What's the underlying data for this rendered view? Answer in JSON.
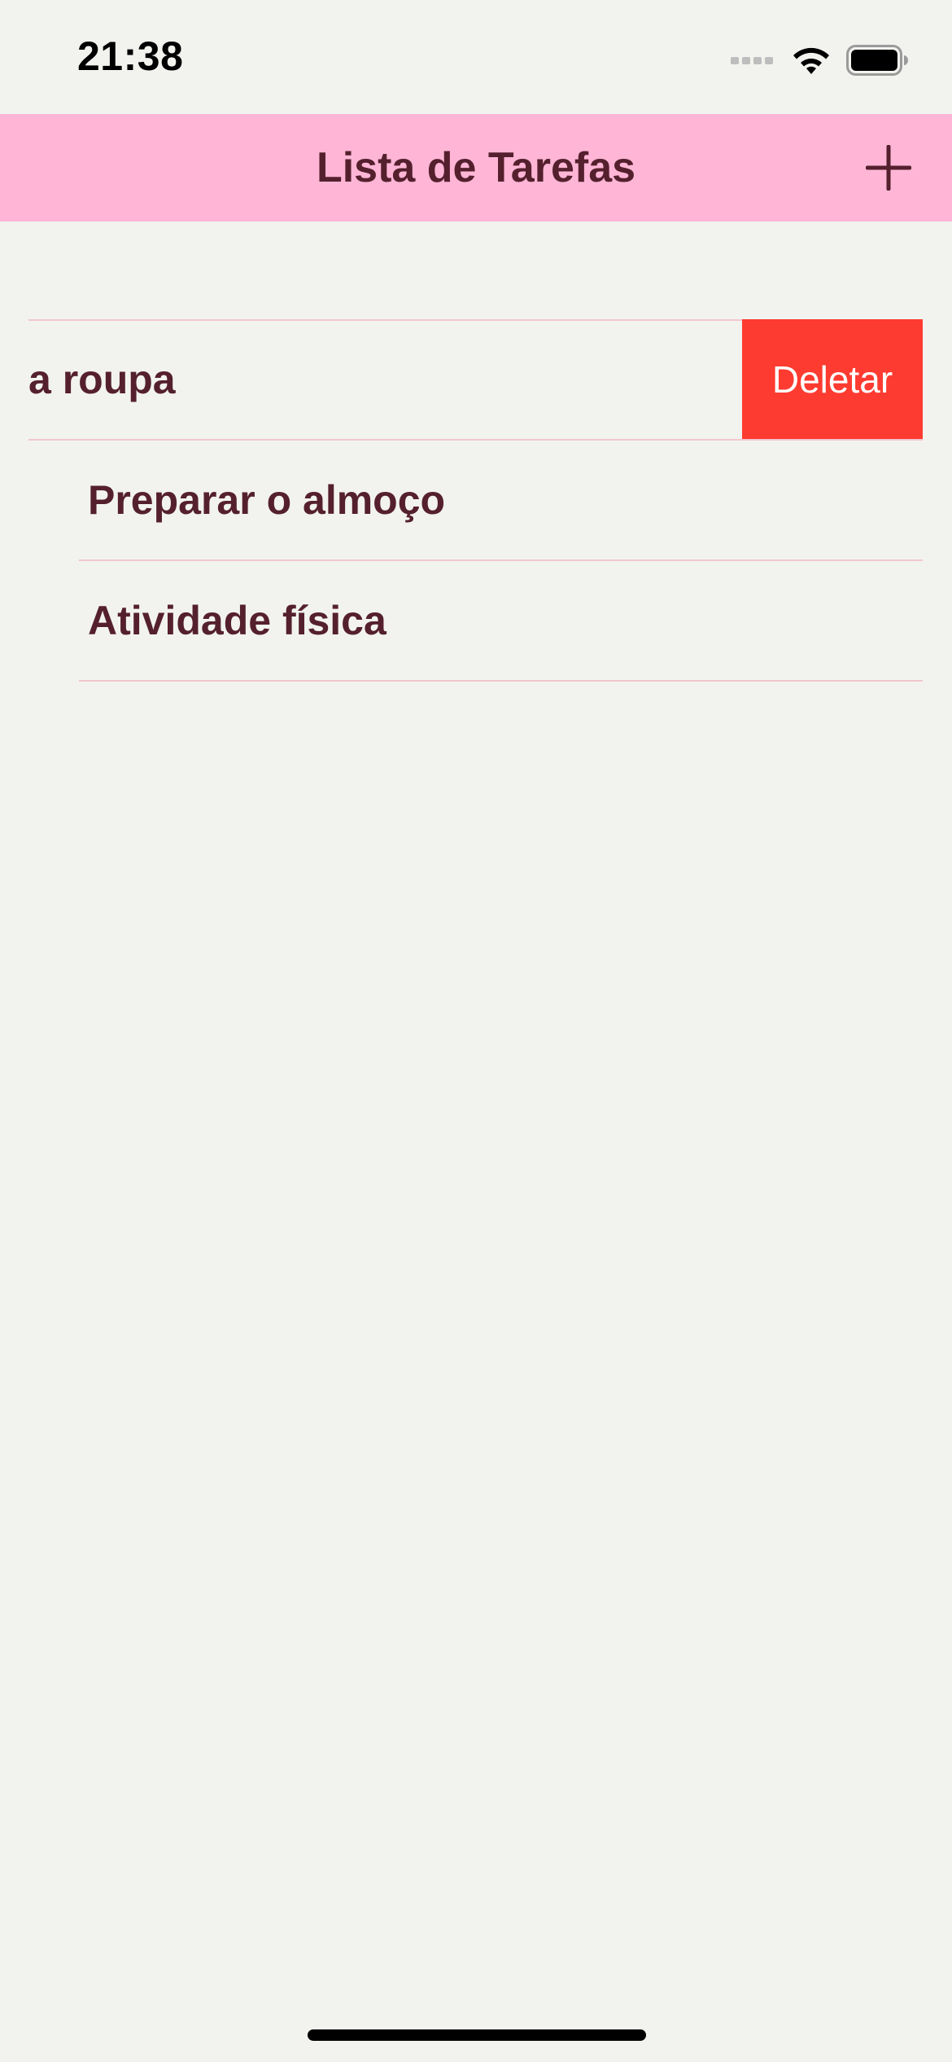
{
  "status_bar": {
    "time": "21:38",
    "icons": [
      "cellular-signal-icon",
      "wifi-icon",
      "battery-icon"
    ]
  },
  "nav_bar": {
    "title": "Lista de Tarefas",
    "add_icon": "plus-icon",
    "background_color": "#ffb6d6"
  },
  "tasks": [
    {
      "label": "a roupa",
      "swiped": true,
      "delete_label": "Deletar"
    },
    {
      "label": "Preparar o almoço",
      "swiped": false
    },
    {
      "label": "Atividade física",
      "swiped": false
    }
  ],
  "colors": {
    "text": "#55202e",
    "delete": "#fe3b30",
    "separator": "#f2c6cd",
    "background": "#f2f3ef"
  }
}
